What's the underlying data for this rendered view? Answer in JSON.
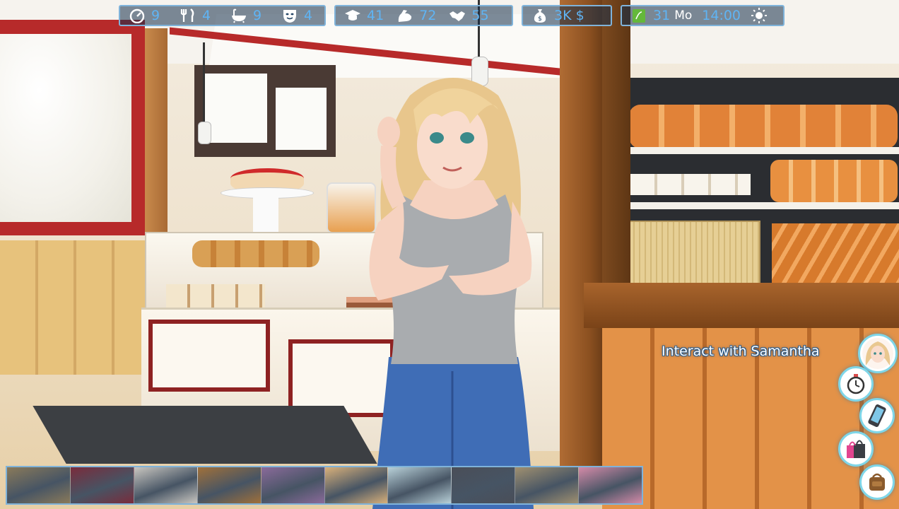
{
  "hud": {
    "needs": [
      {
        "icon": "energy-gauge-icon",
        "value": "9"
      },
      {
        "icon": "fork-knife-icon",
        "value": "4"
      },
      {
        "icon": "bathtub-icon",
        "value": "9"
      },
      {
        "icon": "mood-mask-icon",
        "value": "4"
      }
    ],
    "skills": [
      {
        "icon": "graduation-cap-icon",
        "value": "41"
      },
      {
        "icon": "strength-arm-icon",
        "value": "72"
      },
      {
        "icon": "handshake-icon",
        "value": "55"
      }
    ],
    "money": {
      "icon": "money-bag-icon",
      "value": "3K $"
    },
    "time": {
      "icon": "calendar-icon",
      "day": "31",
      "weekday": "Mo",
      "clock": "14:00",
      "weather_icon": "sun-icon"
    }
  },
  "interact": {
    "label": "Interact with Samantha"
  },
  "side_buttons": [
    {
      "name": "samantha-portrait-button",
      "icon": "character-portrait-icon"
    },
    {
      "name": "wait-button",
      "icon": "stopwatch-icon"
    },
    {
      "name": "phone-button",
      "icon": "phone-icon"
    },
    {
      "name": "shopping-button",
      "icon": "shopping-bag-icon"
    },
    {
      "name": "inventory-button",
      "icon": "backpack-icon"
    }
  ],
  "locations": [
    {
      "name": "mall-lobby",
      "color": "#8a7a5a"
    },
    {
      "name": "arcade",
      "color": "#7a2c3c"
    },
    {
      "name": "kitchen-store",
      "color": "#c9c6c0"
    },
    {
      "name": "bookstore",
      "color": "#a0703a"
    },
    {
      "name": "clothing-store",
      "color": "#8a6a9a"
    },
    {
      "name": "bakery",
      "color": "#d8b07a"
    },
    {
      "name": "pharmacy",
      "color": "#b8d0d8"
    },
    {
      "name": "gym",
      "color": "#4a4e58"
    },
    {
      "name": "restaurant",
      "color": "#a09070"
    },
    {
      "name": "lingerie-store",
      "color": "#d48aa8"
    }
  ]
}
